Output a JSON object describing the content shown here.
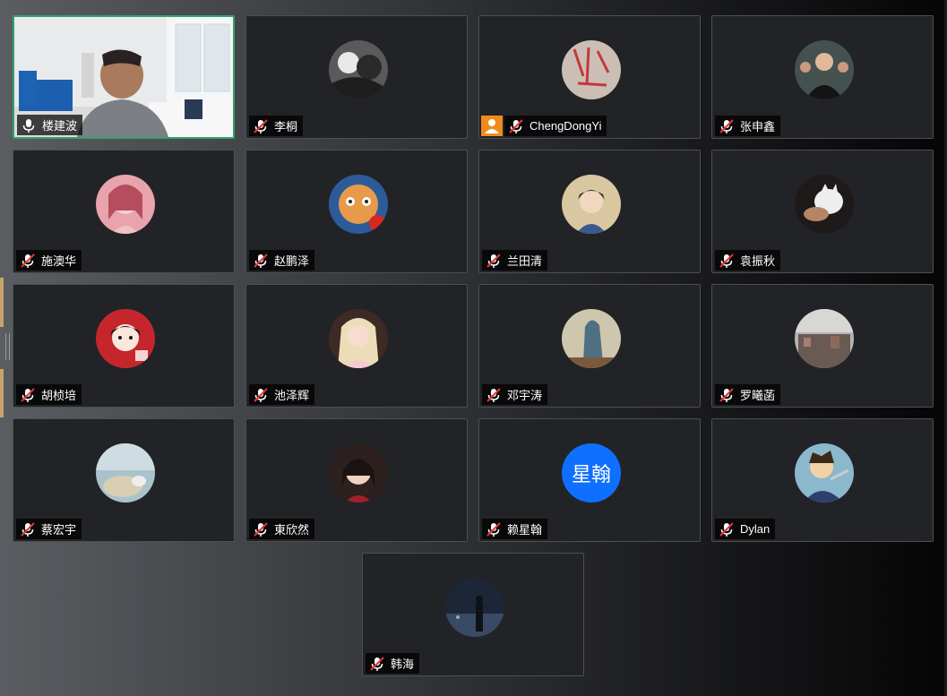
{
  "participants": [
    {
      "name": "楼建波",
      "muted": false,
      "video": true
    },
    {
      "name": "李桐",
      "muted": true,
      "avatar_bg": "#6e6e6e"
    },
    {
      "name": "ChengDongYi",
      "muted": true,
      "host": true,
      "avatar_bg": "#c9bdb4"
    },
    {
      "name": "张申鑫",
      "muted": true,
      "avatar_bg": "#3b4a48"
    },
    {
      "name": "施澳华",
      "muted": true,
      "avatar_bg": "#e59aa6"
    },
    {
      "name": "赵鹏泽",
      "muted": true,
      "avatar_bg": "#e7a04f"
    },
    {
      "name": "兰田清",
      "muted": true,
      "avatar_bg": "#d4c39e"
    },
    {
      "name": "袁振秋",
      "muted": true,
      "avatar_bg": "#2b2624"
    },
    {
      "name": "胡桢培",
      "muted": true,
      "avatar_bg": "#c5262c"
    },
    {
      "name": "池泽辉",
      "muted": true,
      "avatar_bg": "#d9c3b4"
    },
    {
      "name": "邓宇涛",
      "muted": true,
      "avatar_bg": "#bfb8a5"
    },
    {
      "name": "罗曦菡",
      "muted": true,
      "avatar_bg": "#8b8787"
    },
    {
      "name": "蔡宏宇",
      "muted": true,
      "avatar_bg": "#b4c7d0"
    },
    {
      "name": "東欣然",
      "muted": true,
      "avatar_bg": "#3a2c2a"
    },
    {
      "name": "赖星翰",
      "muted": true,
      "avatar_bg": "#0f6fff",
      "avatar_text": "星翰"
    },
    {
      "name": "Dylan",
      "muted": true,
      "avatar_bg": "#89b4c8"
    },
    {
      "name": "韩海",
      "muted": true,
      "avatar_bg": "#2d3a4e"
    }
  ],
  "colors": {
    "active_border": "#33a36a",
    "muted_slash": "#e63535",
    "host_badge": "#f08a1c"
  }
}
